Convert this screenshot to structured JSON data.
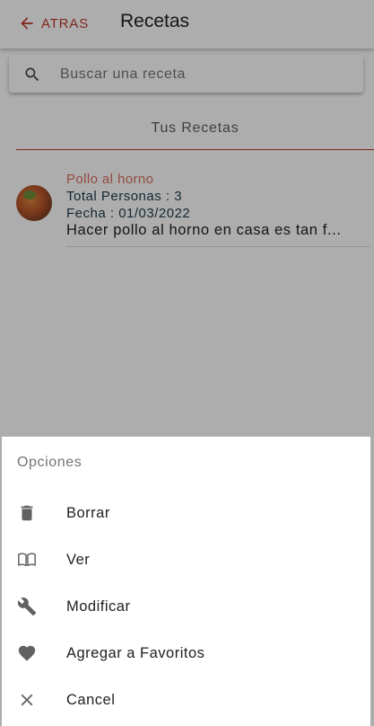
{
  "header": {
    "back_label": "ATRAS",
    "title": "Recetas"
  },
  "search": {
    "placeholder": "Buscar una receta",
    "value": ""
  },
  "tab": {
    "label": "Tus Recetas"
  },
  "recipes": [
    {
      "name": "Pollo al horno",
      "persons_label": "Total Personas :",
      "persons": "3",
      "date_label": "Fecha :",
      "date": "01/03/2022",
      "description": "Hacer pollo al horno en casa es tan f..."
    }
  ],
  "sheet": {
    "title": "Opciones",
    "options": [
      {
        "label": "Borrar",
        "icon": "trash-icon"
      },
      {
        "label": "Ver",
        "icon": "book-icon"
      },
      {
        "label": "Modificar",
        "icon": "wrench-icon"
      },
      {
        "label": "Agregar a Favoritos",
        "icon": "heart-icon"
      },
      {
        "label": "Cancel",
        "icon": "close-icon"
      }
    ]
  },
  "colors": {
    "accent": "#c0392b",
    "recipe_title": "#d9705e"
  }
}
